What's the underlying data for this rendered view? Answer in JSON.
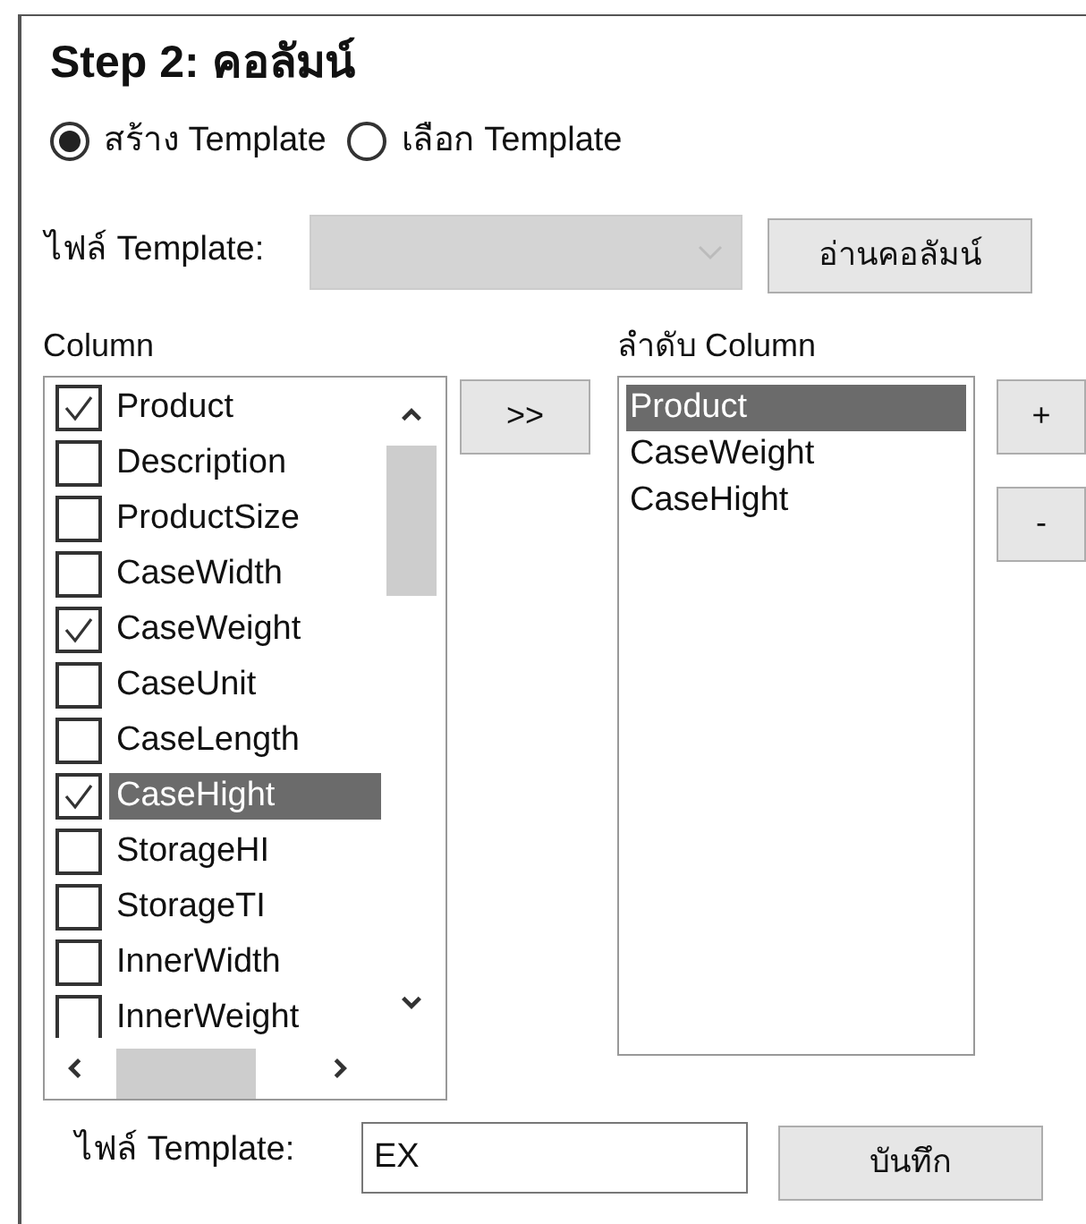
{
  "title": "Step 2: คอลัมน์",
  "modes": [
    {
      "label": "สร้าง Template",
      "selected": true
    },
    {
      "label": "เลือก Template",
      "selected": false
    }
  ],
  "template_picker": {
    "label": "ไฟล์ Template:",
    "disabled": true
  },
  "read_button": "อ่านคอลัมน์",
  "column_list": {
    "label": "Column",
    "items": [
      {
        "name": "Product",
        "checked": true,
        "selected": false
      },
      {
        "name": "Description",
        "checked": false,
        "selected": false
      },
      {
        "name": "ProductSize",
        "checked": false,
        "selected": false
      },
      {
        "name": "CaseWidth",
        "checked": false,
        "selected": false
      },
      {
        "name": "CaseWeight",
        "checked": true,
        "selected": false
      },
      {
        "name": "CaseUnit",
        "checked": false,
        "selected": false
      },
      {
        "name": "CaseLength",
        "checked": false,
        "selected": false
      },
      {
        "name": "CaseHight",
        "checked": true,
        "selected": true
      },
      {
        "name": "StorageHI",
        "checked": false,
        "selected": false
      },
      {
        "name": "StorageTI",
        "checked": false,
        "selected": false
      },
      {
        "name": "InnerWidth",
        "checked": false,
        "selected": false
      },
      {
        "name": "InnerWeight",
        "checked": false,
        "selected": false
      }
    ]
  },
  "move_button": ">>",
  "order_list": {
    "label": "ลำดับ Column",
    "items": [
      {
        "name": "Product",
        "selected": true
      },
      {
        "name": "CaseWeight",
        "selected": false
      },
      {
        "name": "CaseHight",
        "selected": false
      }
    ]
  },
  "up_button": "+",
  "down_button": "-",
  "save_row": {
    "label": "ไฟล์ Template:",
    "value": "EX",
    "button": "บันทึก"
  }
}
